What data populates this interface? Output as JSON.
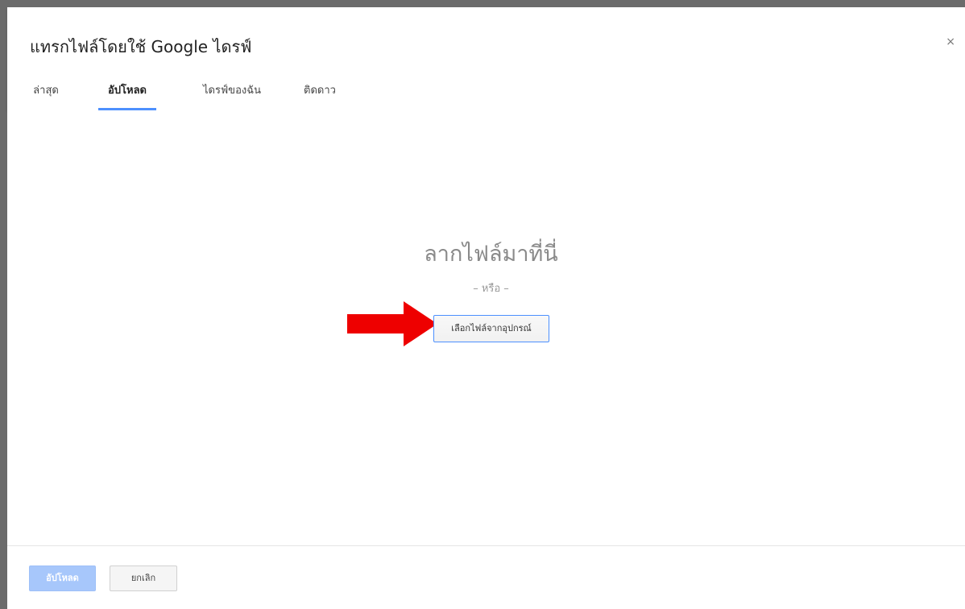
{
  "dialog": {
    "title": "แทรกไฟล์โดยใช้ Google ไดรฟ์",
    "close_label": "×"
  },
  "tabs": [
    {
      "label": "ล่าสุด",
      "active": false
    },
    {
      "label": "อัปโหลด",
      "active": true
    },
    {
      "label": "ไดรฟ์ของฉัน",
      "active": false
    },
    {
      "label": "ติดดาว",
      "active": false
    }
  ],
  "upload_area": {
    "drop_text": "ลากไฟล์มาที่นี่",
    "or_text": "– หรือ –",
    "select_button_label": "เลือกไฟล์จากอุปกรณ์"
  },
  "annotation": {
    "arrow_color": "#ee0000"
  },
  "footer": {
    "upload_button_label": "อัปโหลด",
    "cancel_button_label": "ยกเลิก"
  },
  "colors": {
    "accent": "#4d90fe",
    "upload_button_disabled": "#a7c7fb"
  }
}
